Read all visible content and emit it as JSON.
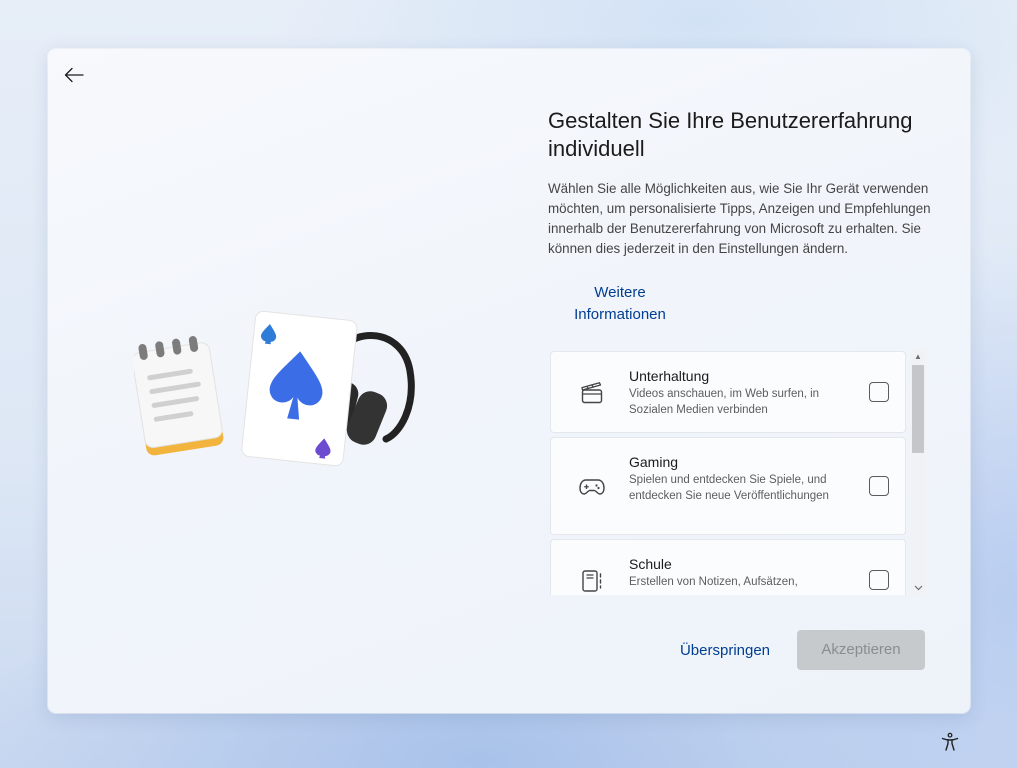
{
  "page": {
    "title": "Gestalten Sie Ihre Benutzererfahrung individuell",
    "description": "Wählen Sie alle Möglichkeiten aus, wie Sie Ihr Gerät verwenden möchten, um personalisierte Tipps, Anzeigen und Empfehlungen innerhalb der Benutzererfahrung von Microsoft zu erhalten. Sie können dies jederzeit in den Einstellungen ändern.",
    "more_info_link": "Weitere Informationen"
  },
  "options": [
    {
      "title": "Unterhaltung",
      "description": "Videos anschauen, im Web surfen, in Sozialen Medien verbinden",
      "icon": "clapperboard-icon",
      "checked": false
    },
    {
      "title": "Gaming",
      "description": "Spielen und entdecken Sie Spiele, und entdecken Sie neue Veröffentlichungen",
      "icon": "gamepad-icon",
      "checked": false
    },
    {
      "title": "Schule",
      "description": "Erstellen von Notizen, Aufsätzen,",
      "icon": "notebook-icon",
      "checked": false
    }
  ],
  "buttons": {
    "skip": "Überspringen",
    "accept": "Akzeptieren",
    "accept_enabled": false
  },
  "icons": {
    "back": "back-arrow-icon",
    "accessibility": "accessibility-icon",
    "scroll_up": "scroll-up-arrow-icon",
    "scroll_down": "scroll-down-arrow-icon"
  },
  "colors": {
    "link": "#003e92",
    "accent": "#2563eb",
    "button_disabled_bg": "#c7cacd",
    "button_disabled_text": "#8a8d90"
  }
}
